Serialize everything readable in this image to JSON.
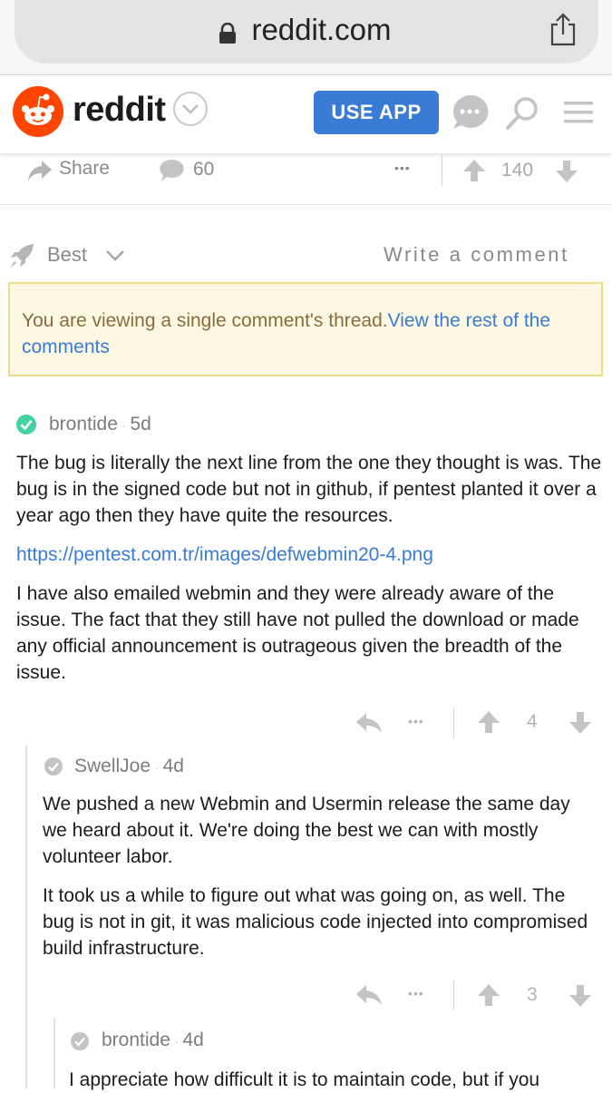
{
  "browser": {
    "url": "reddit.com"
  },
  "header": {
    "wordmark": "reddit",
    "use_app_label": "USE APP"
  },
  "post_actions": {
    "share_label": "Share",
    "comments_count": "60",
    "more": "•••",
    "score": "140"
  },
  "sort": {
    "label": "Best",
    "write_comment": "Write a comment"
  },
  "notice": {
    "text": "You are viewing a single comment's thread.",
    "link": "View the rest of the comments"
  },
  "comments": [
    {
      "author": "brontide",
      "sep": "·",
      "age": "5d",
      "paragraphs": [
        "The bug is literally the next line from the one they thought is was. The bug is in the signed code but not in github, if pentest planted it over a year ago then they have quite the resources.",
        "https://pentest.com.tr/images/defwebmin20-4.png",
        "I have also emailed webmin and they were already aware of the issue. The fact that they still have not pulled the download or made any official announcement is outrageous given the breadth of the issue."
      ],
      "more": "•••",
      "score": "4"
    },
    {
      "author": "SwellJoe",
      "sep": "·",
      "age": "4d",
      "paragraphs": [
        "We pushed a new Webmin and Usermin release the same day we heard about it. We're doing the best we can with mostly volunteer labor.",
        "It took us a while to figure out what was going on, as well. The bug is not in git, it was malicious code injected into compromised build infrastructure."
      ],
      "more": "•••",
      "score": "3"
    },
    {
      "author": "brontide",
      "sep": "·",
      "age": "4d",
      "paragraphs": [
        "I appreciate how difficult it is to maintain code, but if you"
      ]
    }
  ],
  "colors": {
    "accent": "#3a7bd5",
    "reddit_orange": "#ff4500",
    "verified_green": "#46d160",
    "notice_bg": "#fcf8e3"
  }
}
